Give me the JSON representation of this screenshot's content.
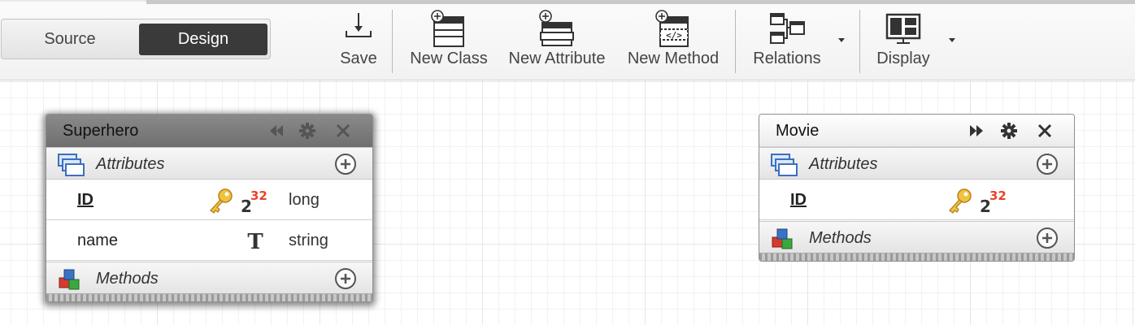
{
  "mode_switch": {
    "source_label": "Source",
    "design_label": "Design",
    "active": "Design"
  },
  "toolbar": {
    "save": "Save",
    "new_class": "New Class",
    "new_attribute": "New Attribute",
    "new_method": "New Method",
    "relations": "Relations",
    "display": "Display",
    "icons": {
      "save": "save-download-icon",
      "new_class": "new-class-icon",
      "new_attribute": "new-attribute-icon",
      "new_method": "new-method-icon",
      "relations": "relations-icon",
      "display": "display-layout-icon"
    }
  },
  "entities": [
    {
      "name": "Superhero",
      "selected": true,
      "header_icons": [
        "collapse-left-icon",
        "gear-icon",
        "close-icon"
      ],
      "attributes_label": "Attributes",
      "attributes": [
        {
          "name": "ID",
          "is_key": true,
          "type_icon": "integer-2-32-icon",
          "type": "long"
        },
        {
          "name": "name",
          "is_key": false,
          "type_icon": "text-T-icon",
          "type": "string"
        }
      ],
      "methods_label": "Methods"
    },
    {
      "name": "Movie",
      "selected": false,
      "header_icons": [
        "expand-right-icon",
        "gear-icon",
        "close-icon"
      ],
      "attributes_label": "Attributes",
      "attributes": [
        {
          "name": "ID",
          "is_key": true,
          "type_icon": "integer-2-32-icon",
          "type": ""
        }
      ],
      "methods_label": "Methods"
    }
  ],
  "colors": {
    "accent_dark": "#3a3a3a",
    "int_icon_red": "#e8432a",
    "key_gold": "#e9b12a"
  }
}
